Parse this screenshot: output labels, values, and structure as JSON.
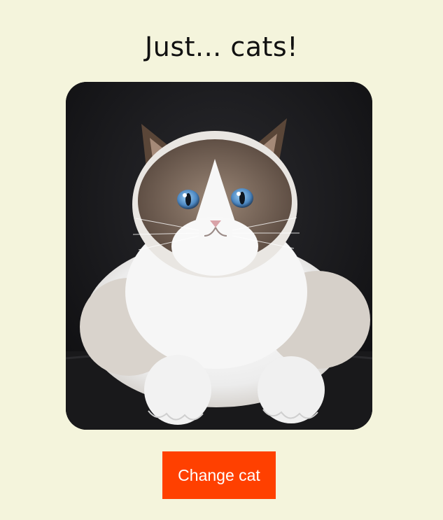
{
  "page": {
    "title": "Just... cats!"
  },
  "image": {
    "subject": "cat-photo",
    "colors": {
      "background": "#141416",
      "fur_white": "#f4f4f4",
      "fur_brown": "#7a6656",
      "eyes": "#5a93c8"
    }
  },
  "controls": {
    "change_label": "Change cat",
    "button_color": "#ff4000"
  },
  "theme": {
    "page_background": "#f4f4dc",
    "text_color": "#111111"
  }
}
